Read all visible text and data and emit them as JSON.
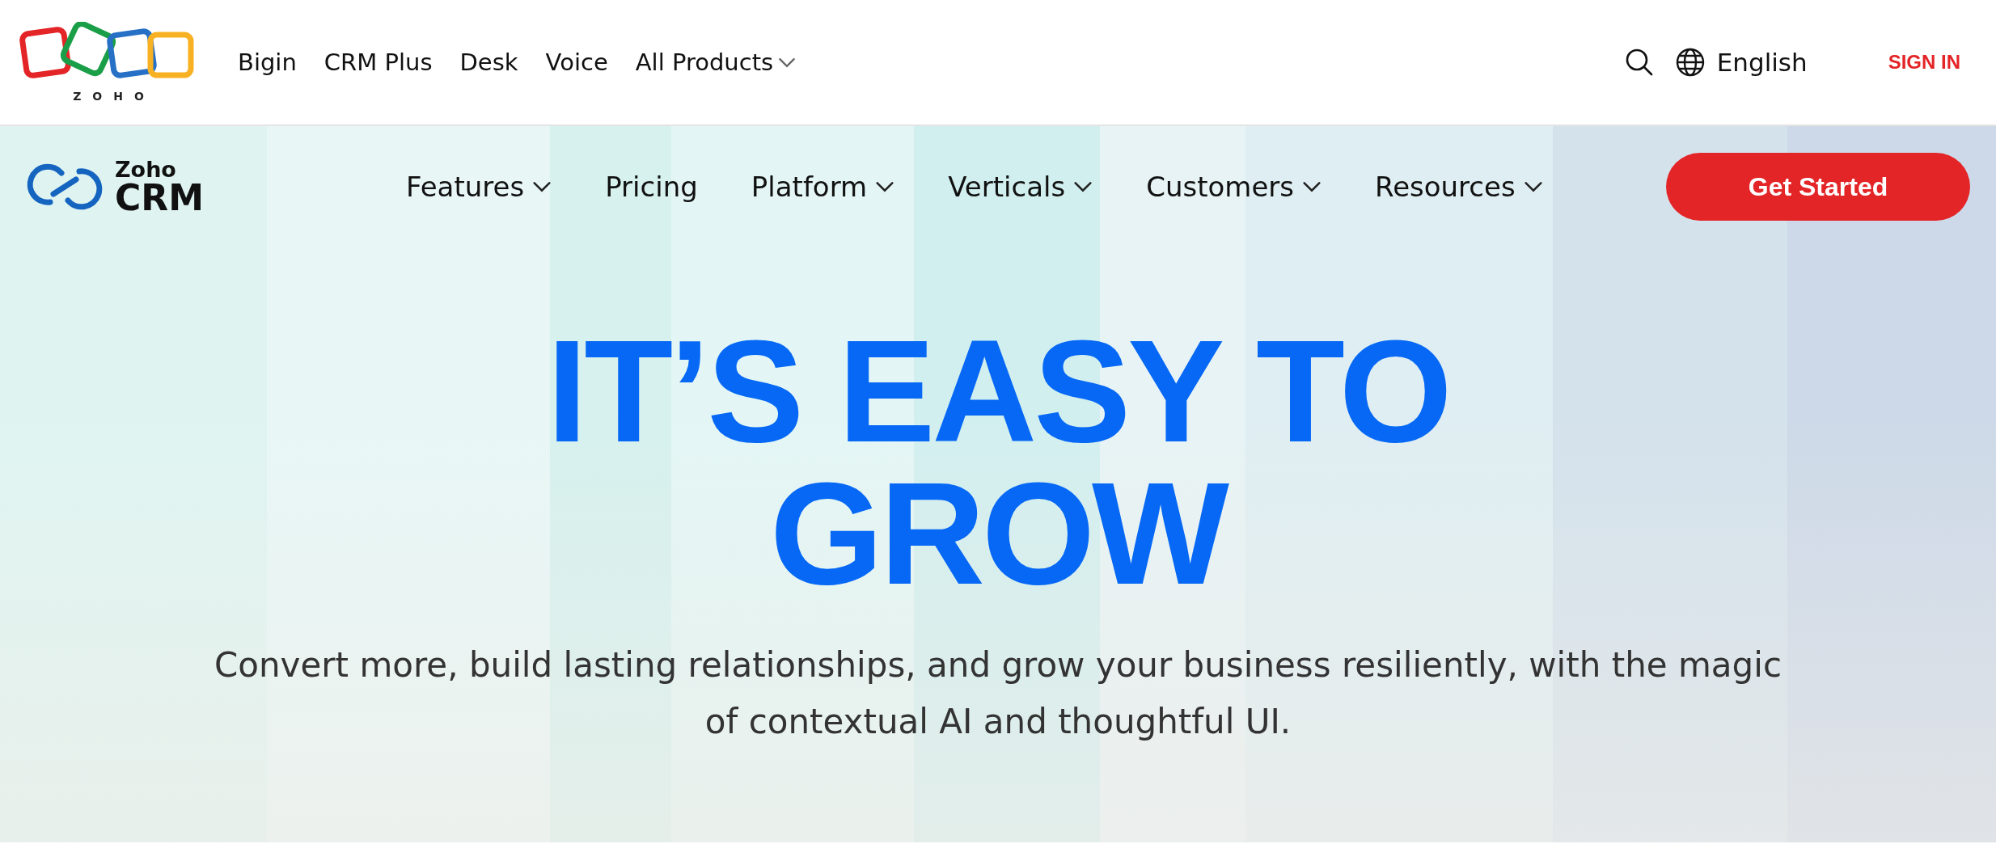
{
  "topbar": {
    "logo_text": "ZOHO",
    "products": [
      {
        "label": "Bigin",
        "dropdown": false
      },
      {
        "label": "CRM Plus",
        "dropdown": false
      },
      {
        "label": "Desk",
        "dropdown": false
      },
      {
        "label": "Voice",
        "dropdown": false
      },
      {
        "label": "All Products",
        "dropdown": true
      }
    ],
    "language": "English",
    "sign_in": "SIGN IN"
  },
  "navbar": {
    "brand_top": "Zoho",
    "brand_bottom": "CRM",
    "items": [
      {
        "label": "Features",
        "dropdown": true
      },
      {
        "label": "Pricing",
        "dropdown": false
      },
      {
        "label": "Platform",
        "dropdown": true
      },
      {
        "label": "Verticals",
        "dropdown": true
      },
      {
        "label": "Customers",
        "dropdown": true
      },
      {
        "label": "Resources",
        "dropdown": true
      }
    ],
    "cta": "Get Started"
  },
  "hero": {
    "headline_lines": [
      "IT’S EASY TO",
      "GROW"
    ],
    "subtitle": "Convert more, build lasting relationships, and grow your business resiliently, with the magic of contextual AI and thoughtful UI."
  }
}
